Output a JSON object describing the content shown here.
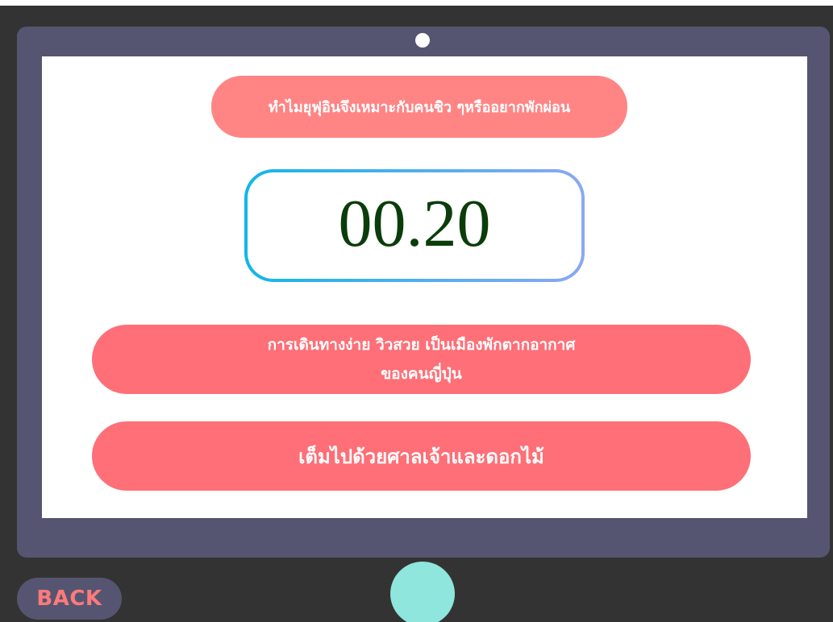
{
  "quiz": {
    "question": "ทำไมยุฟุอินจึงเหมาะกับคนชิว ๆหรืออยากพักผ่อน",
    "timer": "00.20",
    "answers": [
      {
        "lines": [
          "การเดินทางง่าย วิวสวย เป็นเมืองพักตากอากาศ",
          "ของคนญี่ปุ่น"
        ]
      },
      {
        "lines": [
          "เต็มไปด้วยศาลเจ้าและดอกไม้"
        ]
      }
    ]
  },
  "nav": {
    "back_label": "BACK"
  },
  "colors": {
    "background": "#333333",
    "tablet_frame": "#555571",
    "question_pill": "#ff8585",
    "answer_pill": "#fe6f77",
    "timer_text": "#0a3d0a",
    "timer_border_start": "#12b6e7",
    "timer_border_end": "#8ba8f5",
    "back_text": "#ff7a7a",
    "home_button": "#8fe6dc"
  }
}
